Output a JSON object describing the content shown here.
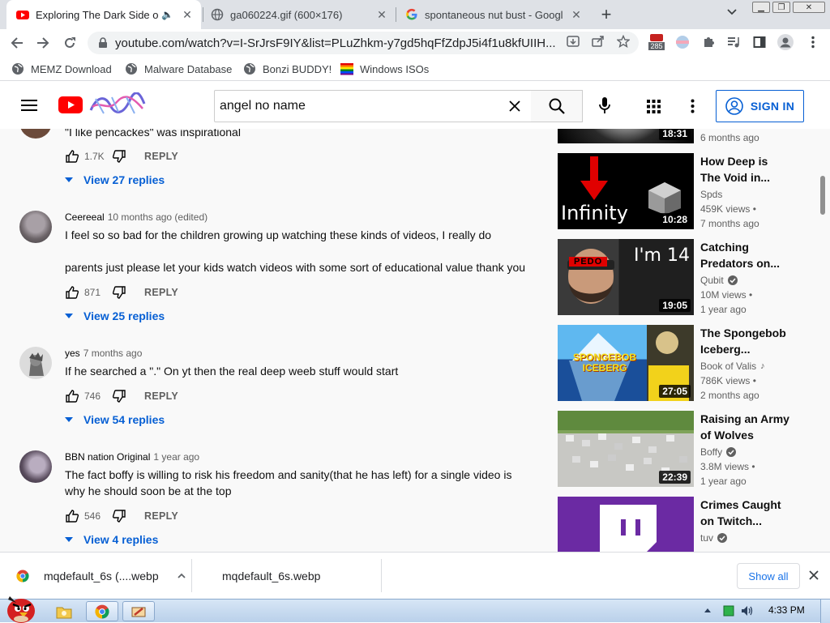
{
  "browser": {
    "tabs": [
      {
        "title": "Exploring The Dark Side of",
        "active": true
      },
      {
        "title": "ga060224.gif (600×176)",
        "active": false
      },
      {
        "title": "spontaneous nut bust - Googl",
        "active": false
      }
    ],
    "new_tab": "+",
    "url": "youtube.com/watch?v=I-SrJrsF9IY&list=PLuZhkm-y7gd5hqFfZdpJ5i4f1u8kfUIIH...",
    "extension_badge": "285",
    "bookmarks": [
      "MEMZ Download",
      "Malware Database",
      "Bonzi BUDDY!",
      "Windows ISOs"
    ]
  },
  "youtube": {
    "search_query": "angel no name",
    "signin_label": "SIGN IN",
    "comments": [
      {
        "author": "",
        "time": "",
        "text": "\"I like pencackes\" was inspirational",
        "likes": "1.7K",
        "reply_label": "REPLY",
        "view_replies": "View 27 replies"
      },
      {
        "author": "Ceereeal",
        "time": "10 months ago (edited)",
        "text": "I feel so so bad for the children growing up watching these kinds of videos, I really do",
        "text2": "parents just please let your kids watch videos with some sort of educational value thank you",
        "likes": "871",
        "reply_label": "REPLY",
        "view_replies": "View 25 replies"
      },
      {
        "author": "yes",
        "time": "7 months ago",
        "text": "If he searched a \".\" On yt then the real deep weeb stuff would start",
        "likes": "746",
        "reply_label": "REPLY",
        "view_replies": "View 54 replies"
      },
      {
        "author": "BBN nation Original",
        "time": "1 year ago",
        "text": "The fact boffy is willing to risk his freedom and sanity(that he has left) for a single video is why he should soon be at the top",
        "likes": "546",
        "reply_label": "REPLY",
        "view_replies": "View 4 replies"
      }
    ],
    "recommendations": [
      {
        "title": "",
        "channel": "",
        "views": "",
        "age": "6 months ago",
        "duration": "18:31"
      },
      {
        "title": "How Deep is The Void in...",
        "channel": "Spds",
        "views": "459K views •",
        "age": "7 months ago",
        "duration": "10:28",
        "thumb_text": "Infinity"
      },
      {
        "title": "Catching Predators on...",
        "channel": "Qubit",
        "views": "10M views •",
        "age": "1 year ago",
        "duration": "19:05",
        "thumb_text": "I'm 14",
        "thumb_badge": "PEDO"
      },
      {
        "title": "The Spongebob Iceberg...",
        "channel": "Book of Valis",
        "views": "786K views •",
        "age": "2 months ago",
        "duration": "27:05",
        "thumb_text": "SPONGEBOB ICEBERG"
      },
      {
        "title": "Raising an Army of Wolves",
        "channel": "Boffy",
        "views": "3.8M views •",
        "age": "1 year ago",
        "duration": "22:39"
      },
      {
        "title": "Crimes Caught on Twitch...",
        "channel": "tuv",
        "views": "",
        "age": "",
        "duration": ""
      }
    ]
  },
  "downloads": {
    "items": [
      "mqdefault_6s (....webp",
      "mqdefault_6s.webp"
    ],
    "show_all": "Show all"
  },
  "taskbar": {
    "clock": "4:33 PM"
  },
  "colors": {
    "youtube_red": "#ff0000",
    "link_blue": "#065fd4",
    "tabstrip": "#dee1e6"
  }
}
